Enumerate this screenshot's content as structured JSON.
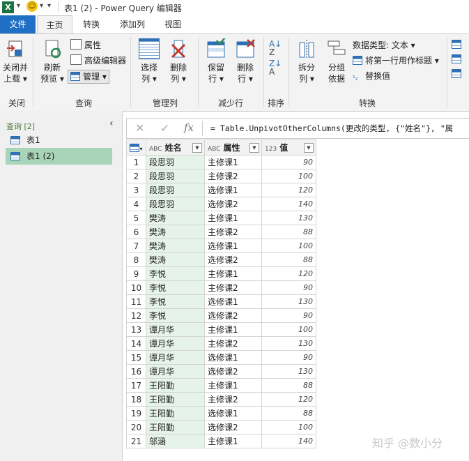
{
  "window": {
    "title": "表1 (2) - Power Query 编辑器",
    "app_icon": "X"
  },
  "menu_tabs": [
    "文件",
    "主页",
    "转换",
    "添加列",
    "视图"
  ],
  "ribbon": {
    "close_load": {
      "line1": "关闭并",
      "line2": "上载",
      "group": "关闭"
    },
    "refresh_preview": {
      "line1": "刷新",
      "line2": "预览"
    },
    "properties": "属性",
    "advanced_editor": "高级编辑器",
    "manage": "管理",
    "query_group": "查询",
    "choose_columns": {
      "line1": "选择",
      "line2": "列"
    },
    "remove_columns": {
      "line1": "删除",
      "line2": "列"
    },
    "manage_columns_group": "管理列",
    "keep_rows": {
      "line1": "保留",
      "line2": "行"
    },
    "remove_rows": {
      "line1": "删除",
      "line2": "行"
    },
    "reduce_rows_group": "减少行",
    "sort_group": "排序",
    "split_column": {
      "line1": "拆分",
      "line2": "列"
    },
    "group_by": {
      "line1": "分组",
      "line2": "依据"
    },
    "data_type": "数据类型: 文本",
    "first_row_headers": "将第一行用作标题",
    "replace_values": "替换值",
    "transform_group": "转换"
  },
  "queries_pane": {
    "header": "查询 [2]",
    "items": [
      "表1",
      "表1 (2)"
    ],
    "selected_index": 1
  },
  "formula_bar": {
    "fx_label": "fx",
    "formula": "= Table.UnpivotOtherColumns(更改的类型, {\"姓名\"}, \"属"
  },
  "table": {
    "columns": [
      {
        "type_icon": "ABC",
        "name": "姓名"
      },
      {
        "type_icon": "ABC",
        "name": "属性"
      },
      {
        "type_icon": "123",
        "name": "值"
      }
    ],
    "rows": [
      [
        "1",
        "段思羽",
        "主修课1",
        "90"
      ],
      [
        "2",
        "段思羽",
        "主修课2",
        "100"
      ],
      [
        "3",
        "段思羽",
        "选修课1",
        "120"
      ],
      [
        "4",
        "段思羽",
        "选修课2",
        "140"
      ],
      [
        "5",
        "樊涛",
        "主修课1",
        "130"
      ],
      [
        "6",
        "樊涛",
        "主修课2",
        "88"
      ],
      [
        "7",
        "樊涛",
        "选修课1",
        "100"
      ],
      [
        "8",
        "樊涛",
        "选修课2",
        "88"
      ],
      [
        "9",
        "李悦",
        "主修课1",
        "120"
      ],
      [
        "10",
        "李悦",
        "主修课2",
        "90"
      ],
      [
        "11",
        "李悦",
        "选修课1",
        "130"
      ],
      [
        "12",
        "李悦",
        "选修课2",
        "90"
      ],
      [
        "13",
        "谭月华",
        "主修课1",
        "100"
      ],
      [
        "14",
        "谭月华",
        "主修课2",
        "130"
      ],
      [
        "15",
        "谭月华",
        "选修课1",
        "90"
      ],
      [
        "16",
        "谭月华",
        "选修课2",
        "130"
      ],
      [
        "17",
        "王阳勤",
        "主修课1",
        "88"
      ],
      [
        "18",
        "王阳勤",
        "主修课2",
        "120"
      ],
      [
        "19",
        "王阳勤",
        "选修课1",
        "88"
      ],
      [
        "20",
        "王阳勤",
        "选修课2",
        "100"
      ],
      [
        "21",
        "邬涵",
        "主修课1",
        "140"
      ]
    ]
  },
  "watermark": "知乎 @数小分",
  "colors": {
    "file_tab": "#1f6fc5",
    "selected_query": "#a8d5b8",
    "name_column_bg": "#e6f3ea"
  }
}
